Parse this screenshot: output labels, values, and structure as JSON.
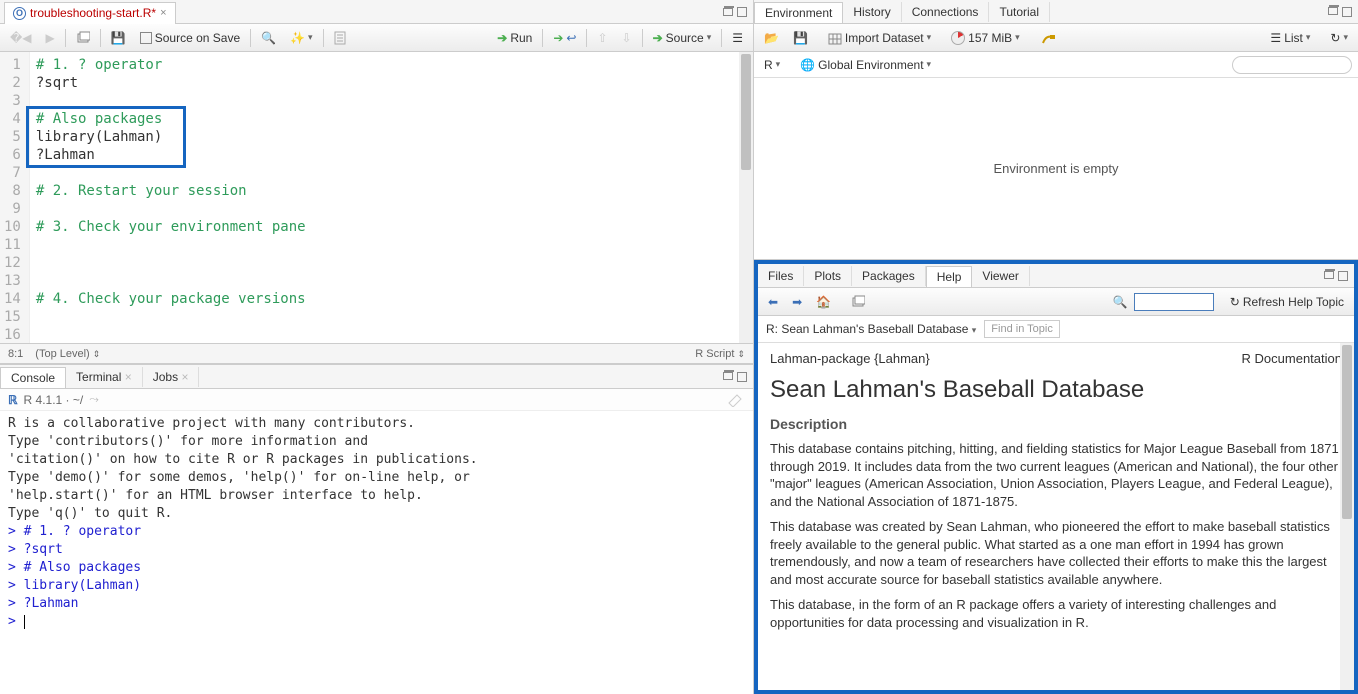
{
  "editor": {
    "tab_title": "troubleshooting-start.R*",
    "source_on_save": "Source on Save",
    "run": "Run",
    "source": "Source",
    "cursor_pos": "8:1",
    "scope": "(Top Level)",
    "lang": "R Script",
    "lines": [
      {
        "n": 1,
        "comment": "# 1. ? operator"
      },
      {
        "n": 2,
        "code": "?sqrt"
      },
      {
        "n": 3,
        "code": ""
      },
      {
        "n": 4,
        "comment": "# Also packages"
      },
      {
        "n": 5,
        "code": "library(Lahman)"
      },
      {
        "n": 6,
        "code": "?Lahman"
      },
      {
        "n": 7,
        "code": ""
      },
      {
        "n": 8,
        "comment": "# 2. Restart your session"
      },
      {
        "n": 9,
        "code": ""
      },
      {
        "n": 10,
        "comment": "# 3. Check your environment pane"
      },
      {
        "n": 11,
        "code": ""
      },
      {
        "n": 12,
        "code": ""
      },
      {
        "n": 13,
        "code": ""
      },
      {
        "n": 14,
        "comment": "# 4. Check your package versions"
      },
      {
        "n": 15,
        "code": ""
      },
      {
        "n": 16,
        "code": ""
      }
    ]
  },
  "console": {
    "tabs": [
      "Console",
      "Terminal",
      "Jobs"
    ],
    "info": "R 4.1.1 · ~/",
    "lines": [
      "R is a collaborative project with many contributors.",
      "Type 'contributors()' for more information and",
      "'citation()' on how to cite R or R packages in publications.",
      "",
      "Type 'demo()' for some demos, 'help()' for on-line help, or",
      "'help.start()' for an HTML browser interface to help.",
      "Type 'q()' to quit R.",
      ""
    ],
    "prompts": [
      "# 1. ? operator",
      "?sqrt",
      "# Also packages",
      "library(Lahman)",
      "?Lahman"
    ]
  },
  "env": {
    "tabs": [
      "Environment",
      "History",
      "Connections",
      "Tutorial"
    ],
    "import": "Import Dataset",
    "mem": "157 MiB",
    "view": "List",
    "scope_label": "R",
    "global": "Global Environment",
    "empty": "Environment is empty"
  },
  "help": {
    "tabs": [
      "Files",
      "Plots",
      "Packages",
      "Help",
      "Viewer"
    ],
    "refresh": "Refresh Help Topic",
    "crumb": "R: Sean Lahman's Baseball Database",
    "find": "Find in Topic",
    "pkg": "Lahman-package {Lahman}",
    "doc": "R Documentation",
    "title": "Sean Lahman's Baseball Database",
    "desc_h": "Description",
    "p1": "This database contains pitching, hitting, and fielding statistics for Major League Baseball from 1871 through 2019. It includes data from the two current leagues (American and National), the four other \"major\" leagues (American Association, Union Association, Players League, and Federal League), and the National Association of 1871-1875.",
    "p2": "This database was created by Sean Lahman, who pioneered the effort to make baseball statistics freely available to the general public. What started as a one man effort in 1994 has grown tremendously, and now a team of researchers have collected their efforts to make this the largest and most accurate source for baseball statistics available anywhere.",
    "p3": "This database, in the form of an R package offers a variety of interesting challenges and opportunities for data processing and visualization in R."
  }
}
